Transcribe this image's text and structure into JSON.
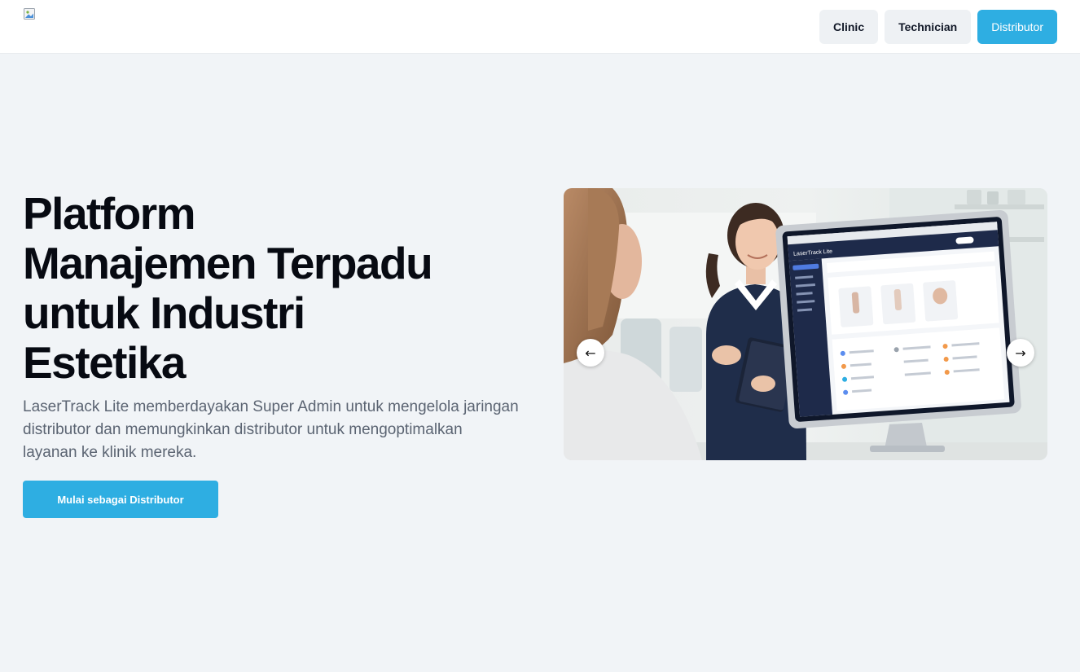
{
  "header": {
    "nav": [
      {
        "label": "Clinic",
        "active": false
      },
      {
        "label": "Technician",
        "active": false
      },
      {
        "label": "Distributor",
        "active": true
      }
    ]
  },
  "hero": {
    "title_lines": [
      "Platform",
      "Manajemen Terpadu",
      "untuk Industri",
      "Estetika"
    ],
    "description": "LaserTrack Lite memberdayakan Super Admin untuk mengelola jaringan distributor dan memungkinkan distributor untuk mengoptimalkan layanan ke klinik mereka.",
    "cta_label": "Mulai sebagai Distributor"
  },
  "carousel": {
    "screen_brand": "LaserTrack Lite",
    "prev_icon": "arrow-left-icon",
    "next_icon": "arrow-right-icon"
  },
  "colors": {
    "accent": "#2eaee2",
    "page_bg": "#f1f4f7",
    "title": "#070a12",
    "body_text": "#5b6472"
  }
}
